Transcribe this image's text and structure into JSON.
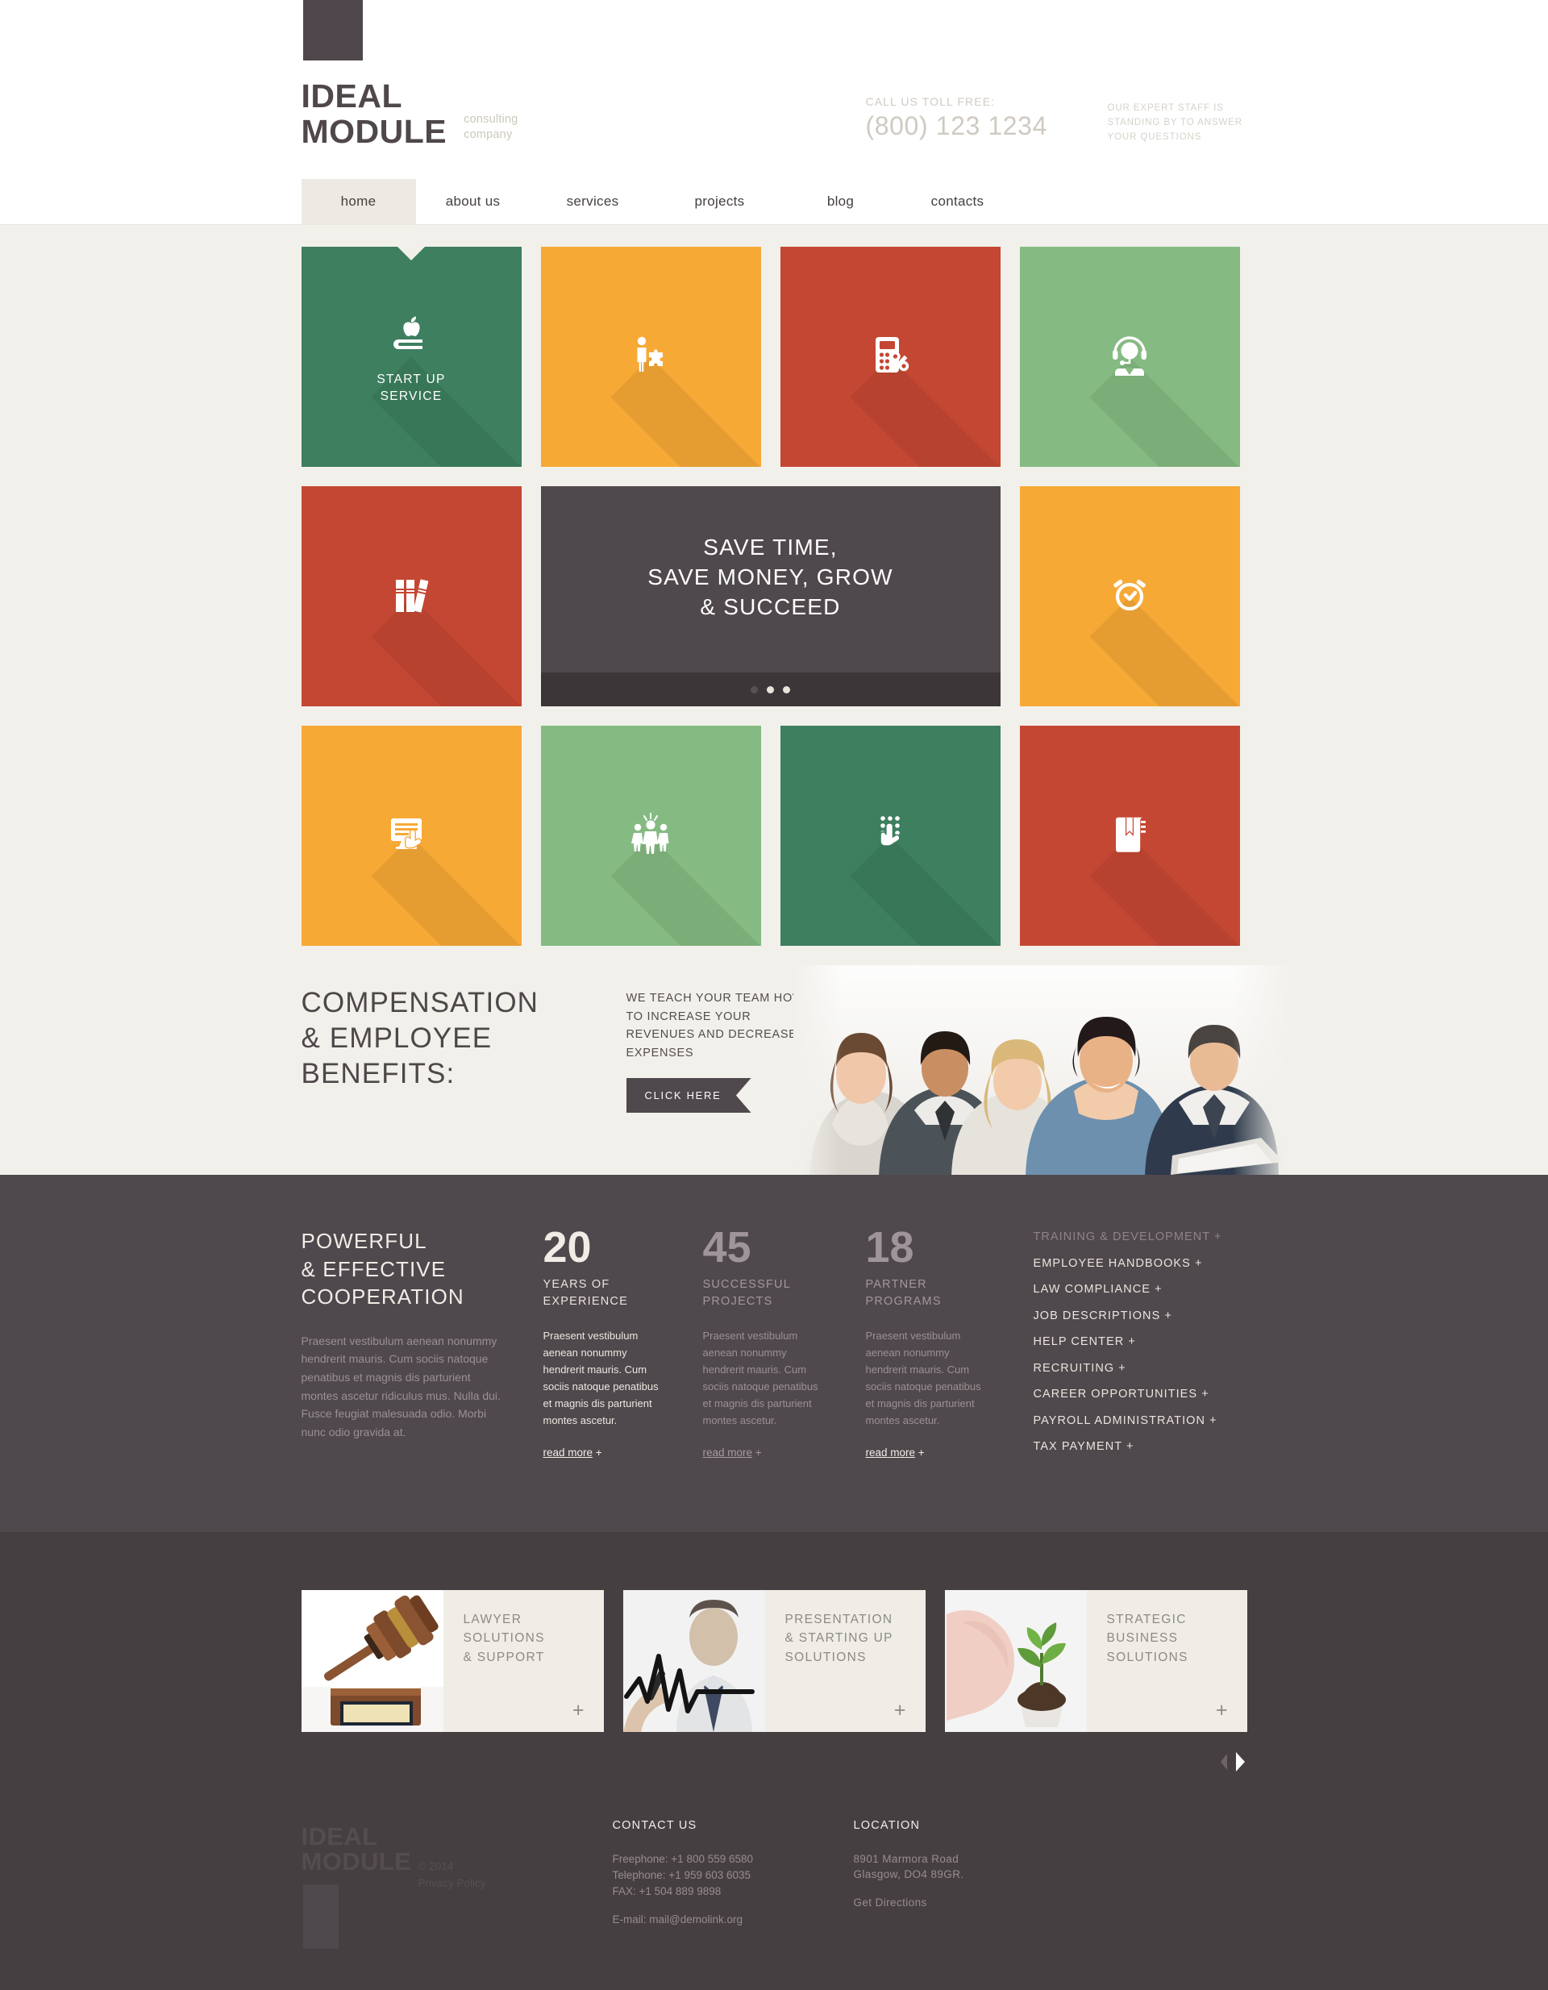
{
  "header": {
    "logo_line1": "IDEAL",
    "logo_line2": "MODULE",
    "tagline_line1": "consulting",
    "tagline_line2": "company",
    "call_label": "CALL US TOLL FREE:",
    "call_number": "(800) 123 1234",
    "expert_line1": "OUR EXPERT STAFF IS",
    "expert_line2": "STANDING BY TO ANSWER",
    "expert_line3": "YOUR QUESTIONS"
  },
  "nav": {
    "items": [
      {
        "label": "home",
        "active": true
      },
      {
        "label": "about us",
        "active": false
      },
      {
        "label": "services",
        "active": false
      },
      {
        "label": "projects",
        "active": false
      },
      {
        "label": "blog",
        "active": false
      },
      {
        "label": "contacts",
        "active": false
      }
    ]
  },
  "tiles": {
    "row1": [
      {
        "icon": "apple-book-icon",
        "color": "#3d7f5f",
        "caption_line1": "START UP",
        "caption_line2": "SERVICE",
        "notch": true
      },
      {
        "icon": "person-puzzle-icon",
        "color": "#f7a936",
        "caption_line1": "",
        "caption_line2": "",
        "notch": false
      },
      {
        "icon": "calculator-percent-icon",
        "color": "#c44733",
        "caption_line1": "",
        "caption_line2": "",
        "notch": false
      },
      {
        "icon": "headset-support-icon",
        "color": "#85bb82",
        "caption_line1": "",
        "caption_line2": "",
        "notch": false
      }
    ],
    "row2_left": {
      "icon": "books-icon",
      "color": "#c44733"
    },
    "row2_right": {
      "icon": "alarm-clock-icon",
      "color": "#f7a936"
    },
    "row3": [
      {
        "icon": "monitor-hand-icon",
        "color": "#f7a936"
      },
      {
        "icon": "team-idea-icon",
        "color": "#85bb82"
      },
      {
        "icon": "hand-keypad-icon",
        "color": "#3d7f5f"
      },
      {
        "icon": "book-bookmark-icon",
        "color": "#c44733"
      }
    ]
  },
  "slider": {
    "line1": "SAVE TIME,",
    "line2": "SAVE MONEY, GROW",
    "line3": "& SUCCEED",
    "dots": [
      {
        "active": false
      },
      {
        "active": true
      },
      {
        "active": true
      }
    ]
  },
  "compensation": {
    "title_line1": "COMPENSATION",
    "title_line2": "& EMPLOYEE",
    "title_line3": "BENEFITS:",
    "subtitle": "WE TEACH YOUR TEAM HOW TO INCREASE YOUR REVENUES AND DECREASE EXPENSES",
    "cta_label": "CLICK HERE"
  },
  "stats": {
    "heading_line1": "POWERFUL",
    "heading_line2": "& EFFECTIVE",
    "heading_line3": "COOPERATION",
    "intro": "Praesent vestibulum aenean nonummy hendrerit mauris. Cum sociis natoque penatibus et magnis dis parturient montes ascetur ridiculus mus. Nulla dui. Fusce feugiat malesuada odio. Morbi nunc odio gravida at.",
    "items": [
      {
        "number": "20",
        "label_line1": "YEARS OF",
        "label_line2": "EXPERIENCE",
        "body": "Praesent vestibulum aenean nonummy hendrerit mauris. Cum sociis natoque penatibus et magnis dis parturient montes ascetur.",
        "read_more": "read more",
        "plus": "+"
      },
      {
        "number": "45",
        "label_line1": "SUCCESSFUL",
        "label_line2": "PROJECTS",
        "body": "Praesent vestibulum aenean nonummy hendrerit mauris. Cum sociis natoque penatibus et magnis dis parturient montes ascetur.",
        "read_more": "read more",
        "plus": "+"
      },
      {
        "number": "18",
        "label_line1": "PARTNER",
        "label_line2": "PROGRAMS",
        "body": "Praesent vestibulum aenean nonummy hendrerit mauris. Cum sociis natoque penatibus et magnis dis parturient montes ascetur.",
        "read_more": "read more",
        "plus": "+"
      }
    ],
    "services": [
      {
        "label": "TRAINING & DEVELOPMENT +",
        "dim": true
      },
      {
        "label": "EMPLOYEE HANDBOOKS +",
        "dim": false
      },
      {
        "label": "LAW COMPLIANCE +",
        "dim": false
      },
      {
        "label": "JOB DESCRIPTIONS +",
        "dim": false
      },
      {
        "label": "HELP CENTER +",
        "dim": false
      },
      {
        "label": "RECRUITING +",
        "dim": false
      },
      {
        "label": "CAREER OPPORTUNITIES +",
        "dim": false
      },
      {
        "label": "PAYROLL ADMINISTRATION +",
        "dim": false
      },
      {
        "label": "TAX PAYMENT +",
        "dim": false
      }
    ]
  },
  "cards": [
    {
      "image": "gavel-photo",
      "title_line1": "LAWYER",
      "title_line2": "SOLUTIONS",
      "title_line3": "& SUPPORT",
      "plus": "+"
    },
    {
      "image": "businessman-chart-photo",
      "title_line1": "PRESENTATION",
      "title_line2": "& STARTING UP",
      "title_line3": "SOLUTIONS",
      "plus": "+"
    },
    {
      "image": "hand-seedling-photo",
      "title_line1": "STRATEGIC",
      "title_line2": "BUSINESS",
      "title_line3": "SOLUTIONS",
      "plus": "+"
    }
  ],
  "footer": {
    "logo_line1": "IDEAL",
    "logo_line2": "MODULE",
    "copyright": "© 2014",
    "privacy": "Privacy Policy",
    "contact_heading": "CONTACT US",
    "freephone": "Freephone: +1 800 559 6580",
    "telephone": "Telephone: +1 959 603 6035",
    "fax": "FAX: +1 504 889 9898",
    "email": "E-mail: mail@demolink.org",
    "location_heading": "LOCATION",
    "address_line1": "8901 Marmora Road",
    "address_line2": "Glasgow, DO4 89GR.",
    "directions": "Get Directions"
  },
  "colors": {
    "green_dark": "#3d7f5f",
    "green_light": "#85bb82",
    "orange": "#f7a936",
    "red": "#c44733",
    "dark": "#4f484c",
    "darker": "#453f42",
    "page_bg": "#f2f0eb"
  }
}
